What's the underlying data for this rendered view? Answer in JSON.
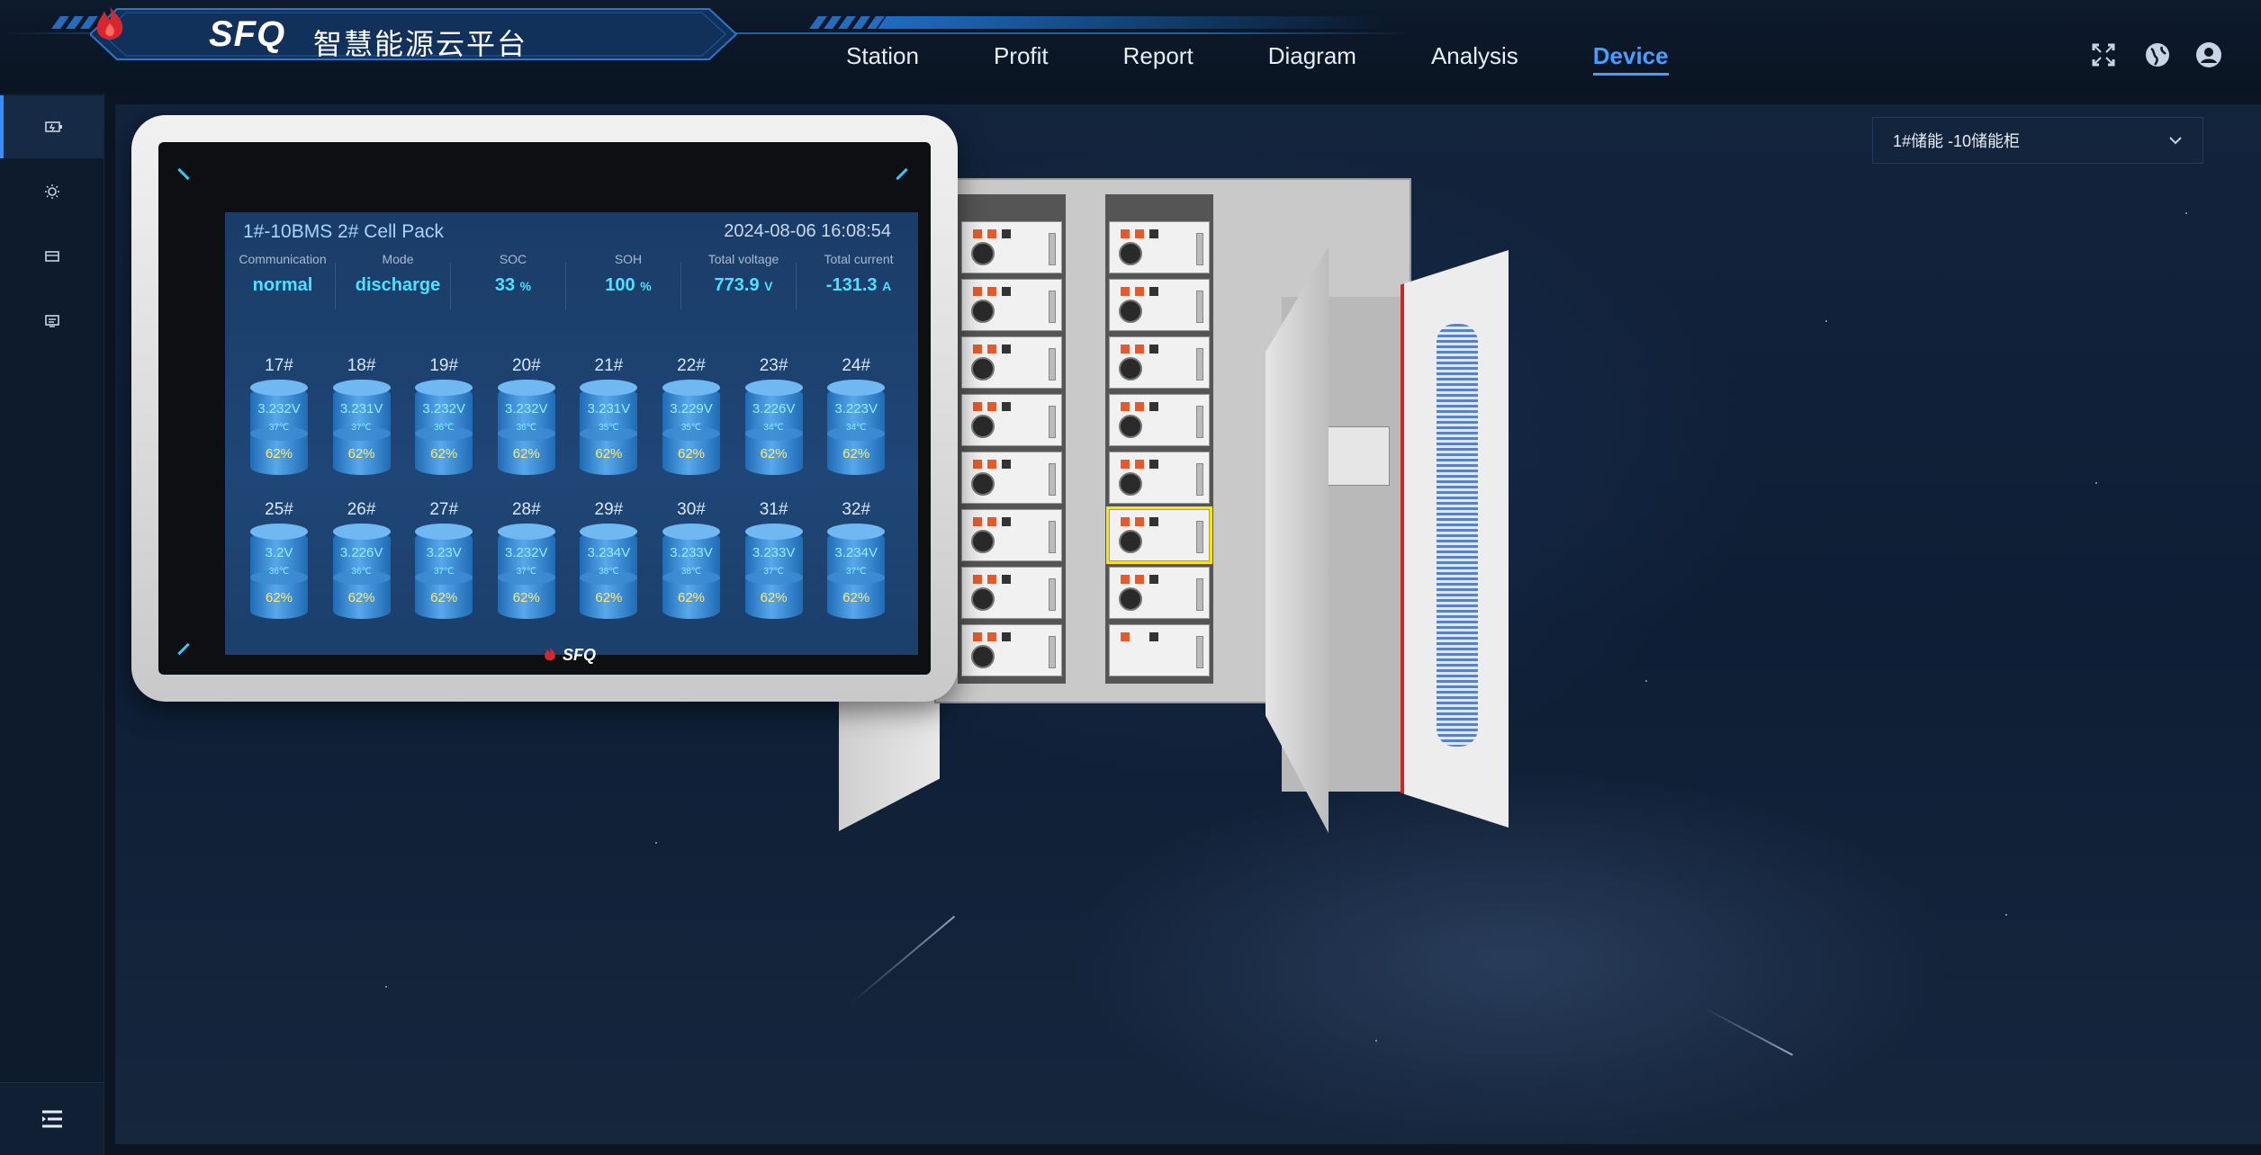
{
  "header": {
    "logo_text": "SFQ",
    "logo_cn": "智慧能源云平台",
    "nav": [
      {
        "label": "Station"
      },
      {
        "label": "Profit"
      },
      {
        "label": "Report"
      },
      {
        "label": "Diagram"
      },
      {
        "label": "Analysis"
      },
      {
        "label": "Device",
        "active": true
      }
    ],
    "icons": [
      "fullscreen-icon",
      "globe-icon",
      "user-icon"
    ]
  },
  "sidebar": {
    "items": [
      {
        "icon": "battery-icon",
        "active": true
      },
      {
        "icon": "sun-icon"
      },
      {
        "icon": "storage-icon"
      },
      {
        "icon": "monitor-icon"
      }
    ],
    "bottom_icon": "menu-icon"
  },
  "device_select": {
    "value": "1#储能 -10储能柜"
  },
  "panel": {
    "title": "1#-10BMS 2# Cell Pack",
    "datetime": "2024-08-06 16:08:54",
    "stats": [
      {
        "label": "Communication",
        "value": "normal",
        "unit": ""
      },
      {
        "label": "Mode",
        "value": "discharge",
        "unit": ""
      },
      {
        "label": "SOC",
        "value": "33",
        "unit": "%"
      },
      {
        "label": "SOH",
        "value": "100",
        "unit": "%"
      },
      {
        "label": "Total voltage",
        "value": "773.9",
        "unit": "V"
      },
      {
        "label": "Total current",
        "value": "-131.3",
        "unit": "A"
      }
    ],
    "cells": [
      {
        "id": "17#",
        "voltage": "3.232V",
        "temp": "37℃",
        "soc": "62%"
      },
      {
        "id": "18#",
        "voltage": "3.231V",
        "temp": "37℃",
        "soc": "62%"
      },
      {
        "id": "19#",
        "voltage": "3.232V",
        "temp": "36℃",
        "soc": "62%"
      },
      {
        "id": "20#",
        "voltage": "3.232V",
        "temp": "36℃",
        "soc": "62%"
      },
      {
        "id": "21#",
        "voltage": "3.231V",
        "temp": "35℃",
        "soc": "62%"
      },
      {
        "id": "22#",
        "voltage": "3.229V",
        "temp": "35℃",
        "soc": "62%"
      },
      {
        "id": "23#",
        "voltage": "3.226V",
        "temp": "34℃",
        "soc": "62%"
      },
      {
        "id": "24#",
        "voltage": "3.223V",
        "temp": "34℃",
        "soc": "62%"
      },
      {
        "id": "25#",
        "voltage": "3.2V",
        "temp": "36℃",
        "soc": "62%"
      },
      {
        "id": "26#",
        "voltage": "3.226V",
        "temp": "36℃",
        "soc": "62%"
      },
      {
        "id": "27#",
        "voltage": "3.23V",
        "temp": "37℃",
        "soc": "62%"
      },
      {
        "id": "28#",
        "voltage": "3.232V",
        "temp": "37℃",
        "soc": "62%"
      },
      {
        "id": "29#",
        "voltage": "3.234V",
        "temp": "38℃",
        "soc": "62%"
      },
      {
        "id": "30#",
        "voltage": "3.233V",
        "temp": "38℃",
        "soc": "62%"
      },
      {
        "id": "31#",
        "voltage": "3.233V",
        "temp": "37℃",
        "soc": "62%"
      },
      {
        "id": "32#",
        "voltage": "3.234V",
        "temp": "37℃",
        "soc": "62%"
      }
    ],
    "footer_logo": "SFQ"
  }
}
